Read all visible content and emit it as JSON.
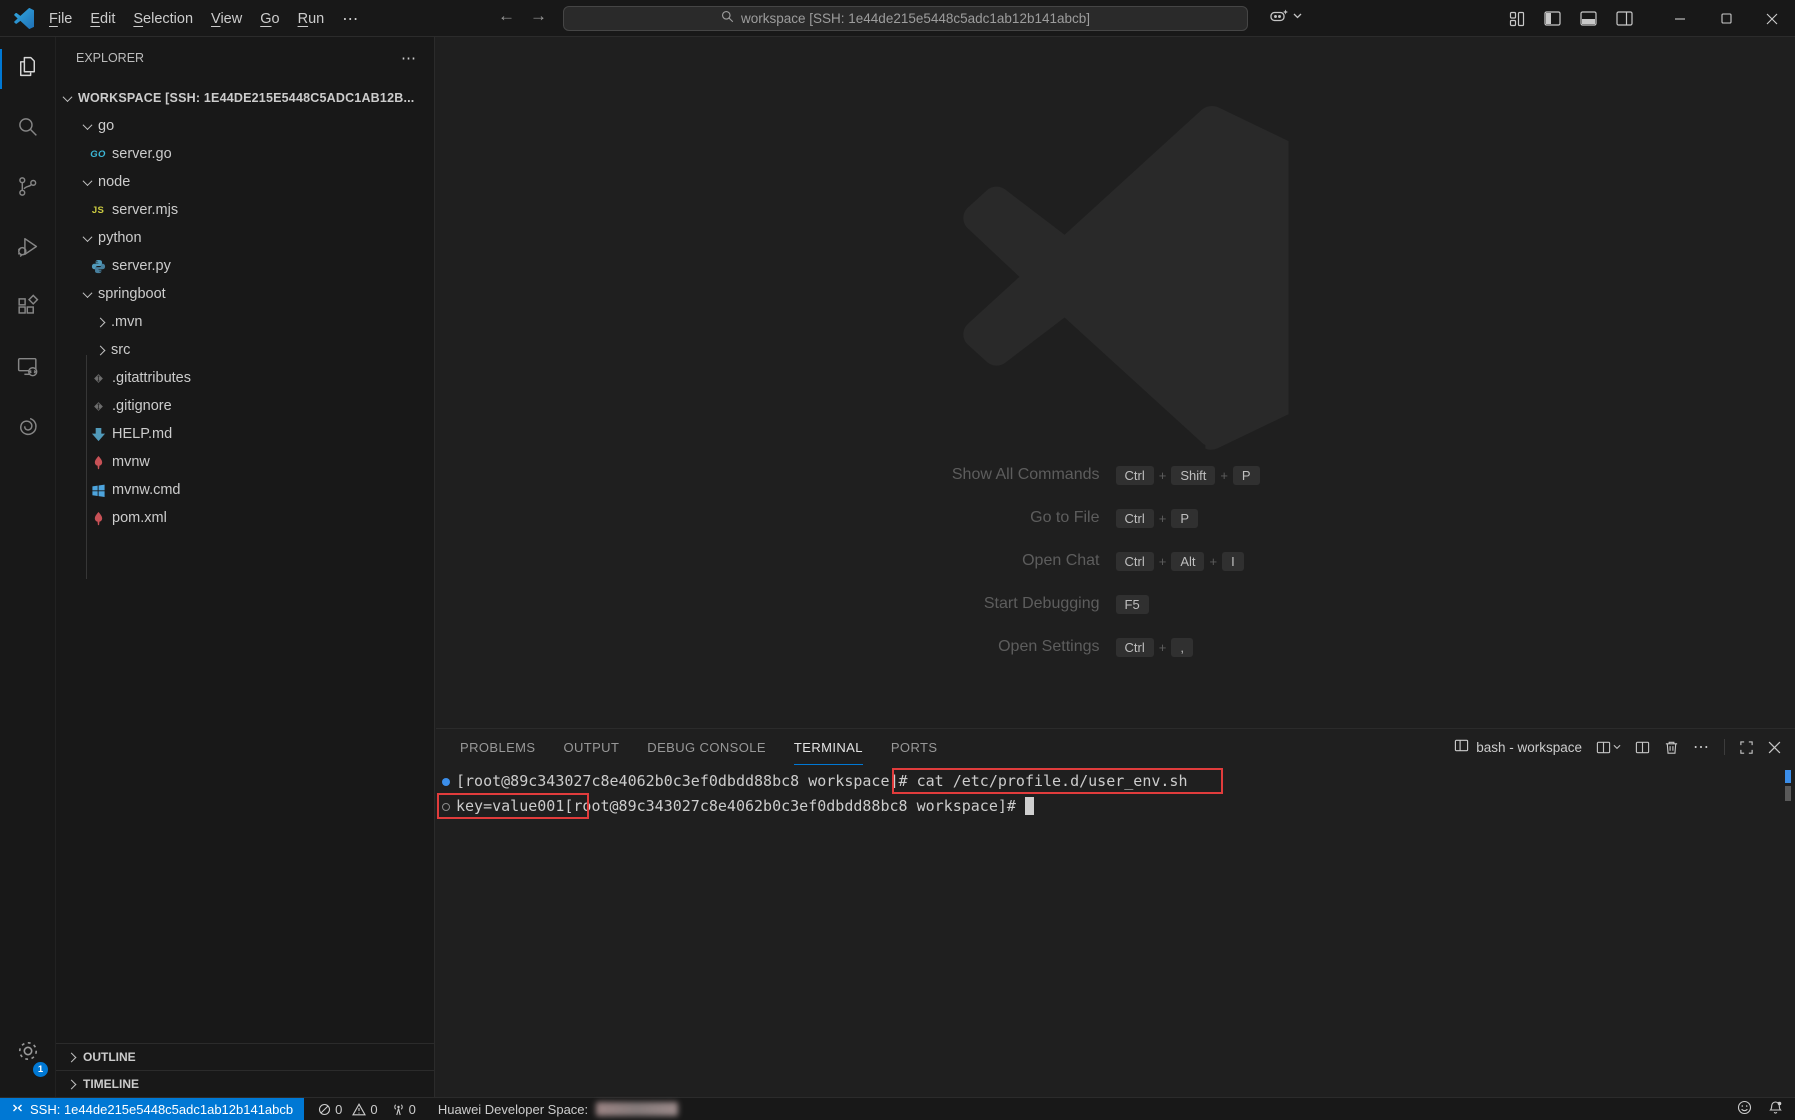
{
  "titlebar": {
    "menus": [
      "File",
      "Edit",
      "Selection",
      "View",
      "Go",
      "Run"
    ],
    "more_glyph": "⋯",
    "back_glyph": "←",
    "forward_glyph": "→",
    "command_center": "workspace [SSH: 1e44de215e5448c5adc1ab12b141abcb]"
  },
  "explorer": {
    "title": "EXPLORER",
    "more_glyph": "⋯",
    "workspace_label": "WORKSPACE [SSH: 1E44DE215E5448C5ADC1AB12B...",
    "tree": [
      {
        "label": "go"
      },
      {
        "label": "server.go",
        "icon_text": "GO"
      },
      {
        "label": "node"
      },
      {
        "label": "server.mjs",
        "icon_text": "JS"
      },
      {
        "label": "python"
      },
      {
        "label": "server.py"
      },
      {
        "label": "springboot"
      },
      {
        "label": ".mvn"
      },
      {
        "label": "src"
      },
      {
        "label": ".gitattributes"
      },
      {
        "label": ".gitignore"
      },
      {
        "label": "HELP.md"
      },
      {
        "label": "mvnw"
      },
      {
        "label": "mvnw.cmd"
      },
      {
        "label": "pom.xml"
      }
    ],
    "outline_label": "OUTLINE",
    "timeline_label": "TIMELINE"
  },
  "editor": {
    "plus": "+",
    "shortcuts": [
      {
        "label": "Show All Commands",
        "keys": [
          "Ctrl",
          "Shift",
          "P"
        ]
      },
      {
        "label": "Go to File",
        "keys": [
          "Ctrl",
          "P"
        ]
      },
      {
        "label": "Open Chat",
        "keys": [
          "Ctrl",
          "Alt",
          "I"
        ]
      },
      {
        "label": "Start Debugging",
        "keys": [
          "F5"
        ]
      },
      {
        "label": "Open Settings",
        "keys": [
          "Ctrl",
          ","
        ]
      }
    ]
  },
  "panel": {
    "tabs": [
      "PROBLEMS",
      "OUTPUT",
      "DEBUG CONSOLE",
      "TERMINAL",
      "PORTS"
    ],
    "active_tab": "TERMINAL",
    "terminal_label": "bash - workspace",
    "more_glyph": "⋯",
    "terminal": {
      "line1": "[root@89c343027c8e4062b0c3ef0dbdd88bc8 workspace]# cat /etc/profile.d/user_env.sh",
      "line2": "key=value001[root@89c343027c8e4062b0c3ef0dbdd88bc8 workspace]# "
    }
  },
  "status_bar": {
    "remote": "SSH: 1e44de215e5448c5adc1ab12b141abcb",
    "errors": "0",
    "warnings": "0",
    "ports": "0",
    "huawei_label": "Huawei Developer Space:"
  },
  "activity_bar": {
    "badge": "1",
    "icons": [
      "explorer-icon",
      "search-icon",
      "source-control-icon",
      "run-debug-icon",
      "extensions-icon",
      "remote-explorer-icon",
      "huawei-cloud-icon",
      "gear-icon"
    ]
  },
  "colors": {
    "accent": "#0078d4",
    "annotation_red": "#e13c3c",
    "remote_blue": "#0078d4",
    "editor_bg": "#1f1f1f",
    "chrome_bg": "#181818"
  }
}
